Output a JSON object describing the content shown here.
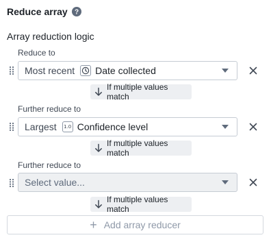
{
  "header": {
    "title": "Reduce array"
  },
  "section_label": "Array reduction logic",
  "reducers": [
    {
      "label": "Reduce to",
      "aggregation": "Most recent",
      "field_icon": "clock-icon",
      "field": "Date collected",
      "match_label": "If multiple values match"
    },
    {
      "label": "Further reduce to",
      "aggregation": "Largest",
      "field_icon_text": "1.0",
      "field": "Confidence level",
      "match_label": "If multiple values match"
    },
    {
      "label": "Further reduce to",
      "placeholder": "Select value...",
      "match_label": "If multiple values match"
    }
  ],
  "add_button": {
    "label": "Add array reducer"
  },
  "colors": {
    "text": "#1c2127",
    "muted": "#5f6b7c",
    "border": "#c5cbd3",
    "chip_bg": "#edeff2",
    "add_text": "#8f99a8"
  }
}
